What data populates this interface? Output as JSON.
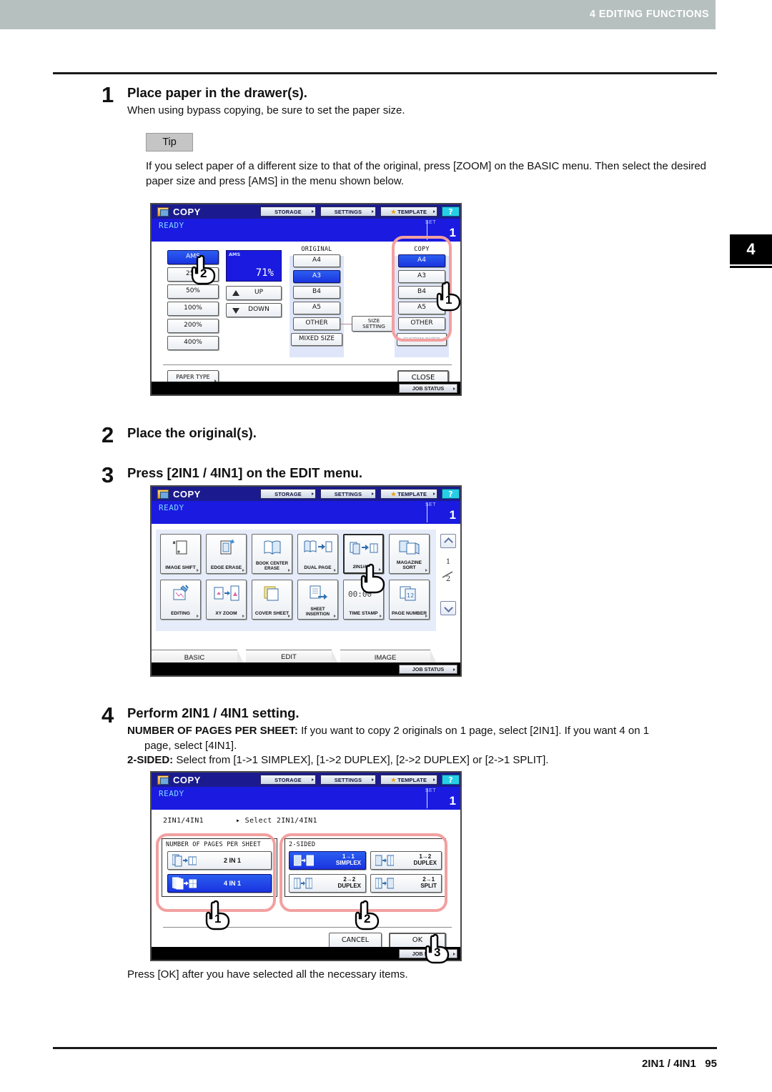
{
  "running_head": {
    "text": "4 EDITING FUNCTIONS"
  },
  "chapter_tab": {
    "number": "4"
  },
  "footer": {
    "text": "2IN1 / 4IN1   95"
  },
  "steps": [
    {
      "number": "1",
      "title": "Place paper in the drawer(s).",
      "body": "When using bypass copying, be sure to set the paper size.",
      "tip_label": "Tip",
      "tip_body": "If you select paper of a different size to that of the original, press [ZOOM] on the BASIC menu. Then select the desired paper size and press [AMS] in the menu shown below."
    },
    {
      "number": "2",
      "title": "Place the original(s)."
    },
    {
      "number": "3",
      "title": "Press [2IN1 / 4IN1] on the EDIT menu."
    },
    {
      "number": "4",
      "title": "Perform 2IN1 / 4IN1 setting.",
      "line1_bold": "NUMBER OF PAGES PER SHEET:",
      "line1": " If you want to copy 2 originals on 1 page, select [2IN1]. If you want 4 on 1",
      "line1b": "page, select [4IN1].",
      "line2_bold": "2-SIDED:",
      "line2": " Select from [1->1 SIMPLEX], [1->2 DUPLEX], [2->2 DUPLEX] or [2->1 SPLIT].",
      "after": "Press [OK] after you have selected all the necessary items."
    }
  ],
  "screen_common": {
    "app_title": "COPY",
    "storage": "STORAGE",
    "settings": "SETTINGS",
    "template": "TEMPLATE",
    "help": "?",
    "ready": "READY",
    "set_label": "SET",
    "set_value": "1",
    "job_status": "JOB STATUS"
  },
  "screen_zoom": {
    "ratio_buttons": [
      "AMS",
      "25%",
      "50%",
      "100%",
      "200%",
      "400%"
    ],
    "zoom_display": {
      "label": "AMS",
      "value": "71%"
    },
    "up": "UP",
    "down": "DOWN",
    "original_label": "ORIGINAL",
    "original_sizes": [
      "A4",
      "A3",
      "B4",
      "A5",
      "OTHER",
      "MIXED SIZE"
    ],
    "original_selected": "A3",
    "copy_label": "COPY",
    "copy_sizes": [
      "A4",
      "A3",
      "B4",
      "A5",
      "OTHER",
      "CUSTOM PAPER"
    ],
    "copy_selected": "A4",
    "size_setting": "SIZE SETTING",
    "paper_type": "PAPER TYPE",
    "close": "CLOSE",
    "callouts": [
      "1",
      "2"
    ]
  },
  "screen_edit": {
    "tiles_row1": [
      {
        "label": "IMAGE SHIFT",
        "icon": "image-shift-icon"
      },
      {
        "label": "EDGE ERASE",
        "icon": "edge-erase-icon"
      },
      {
        "label": "BOOK CENTER ERASE",
        "icon": "book-center-erase-icon"
      },
      {
        "label": "DUAL PAGE",
        "icon": "dual-page-icon"
      },
      {
        "label": "2IN1/4IN1",
        "icon": "2in1-4in1-icon"
      },
      {
        "label": "MAGAZINE SORT",
        "icon": "magazine-sort-icon"
      }
    ],
    "tiles_row2": [
      {
        "label": "EDITING",
        "icon": "editing-icon"
      },
      {
        "label": "XY ZOOM",
        "icon": "xy-zoom-icon"
      },
      {
        "label": "COVER SHEET",
        "icon": "cover-sheet-icon"
      },
      {
        "label": "SHEET INSERTION",
        "icon": "sheet-insertion-icon"
      },
      {
        "label": "TIME STAMP",
        "icon": "time-stamp-icon"
      },
      {
        "label": "PAGE NUMBER",
        "icon": "page-number-icon"
      }
    ],
    "time_stamp_value": "00:00",
    "page_indicator": {
      "current": "1",
      "total": "2"
    },
    "tabs": [
      "BASIC",
      "EDIT",
      "IMAGE"
    ],
    "active_tab": "EDIT"
  },
  "screen_2in1": {
    "breadcrumb_title": "2IN1/4IN1",
    "breadcrumb_path": "Select 2IN1/4IN1",
    "group_pages_label": "NUMBER OF PAGES PER SHEET",
    "pages_options": [
      {
        "label": "2 IN 1",
        "selected": false
      },
      {
        "label": "4 IN 1",
        "selected": true
      }
    ],
    "group_sided_label": "2-SIDED",
    "sided_options": [
      {
        "line1": "1→1",
        "line2": "SIMPLEX",
        "selected": true
      },
      {
        "line1": "1→2",
        "line2": "DUPLEX",
        "selected": false
      },
      {
        "line1": "2→2",
        "line2": "DUPLEX",
        "selected": false
      },
      {
        "line1": "2→1",
        "line2": "SPLIT",
        "selected": false
      }
    ],
    "cancel": "CANCEL",
    "ok": "OK",
    "callouts": [
      "1",
      "2",
      "3"
    ]
  }
}
